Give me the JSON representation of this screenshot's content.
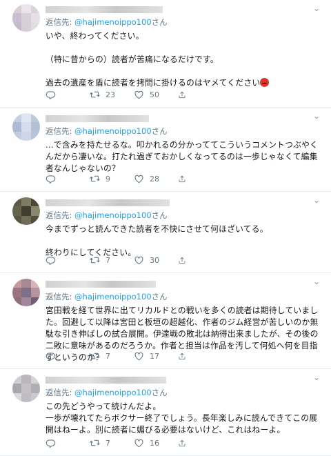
{
  "reply_prefix": "返信先: ",
  "reply_suffix": "さん",
  "tweets": [
    {
      "reply_handle": "@hajimenoippo100",
      "text": "いや、終わってください。\n\n（特に昔からの）読者が苦痛になるだけです。\n\n過去の遺産を盾に読者を拷問に掛けるのはヤメてください",
      "emoji": "angry-face",
      "retweets": "23",
      "likes": "50",
      "avatar_colors": [
        "#d9d0d6",
        "#ebe4ea",
        "#dcd3d9",
        "#c8bfd0",
        "#d8cfd8",
        "#e6e0e6",
        "#c4bccc",
        "#d6cfd6",
        "#e2dce2"
      ]
    },
    {
      "reply_handle": "@hajimenoippo100",
      "text": "...で含みを持たせるな。叩かれるの分かっててこういうコメントつぶやくんだから凄いな。打たれ過ぎておかしくなってるのは一歩じゃなくて編集者なんじゃないの？",
      "retweets": "9",
      "likes": "28",
      "avatar_colors": [
        "#c7cfe3",
        "#dfe5f1",
        "#bcc6dc",
        "#aebad3",
        "#d6dcec",
        "#b3bfd7",
        "#c3cbe0",
        "#cfd6e8",
        "#b8c2da"
      ]
    },
    {
      "reply_handle": "@hajimenoippo100",
      "text": "今までずっと読んできた読者を不快にさせて何ほざいてる。\n\n終わりにしてください。",
      "retweets": "7",
      "likes": "30",
      "avatar_colors": [
        "#5c5a46",
        "#7d7b62",
        "#4a4938",
        "#66644f",
        "#3f3e31",
        "#8a876d",
        "#595743",
        "#706e58",
        "#4f4e3c"
      ]
    },
    {
      "reply_handle": "@hajimenoippo100",
      "text": "宮田戦を経て世界に出てリカルドとの戦いを多くの読者は期待していました。回避して以降は宮田と板垣の超越化、作者のジム経営が苦しいのか無駄な引き伸ばしの試合展開。伊達戦の敗北は納得出来ましたが、その後の二敗に意味があるのだろうか。作者と担当は作品を汚して何処へ何を目指すというのか？",
      "retweets": "7",
      "likes": "17",
      "avatar_colors": [
        "#c89a9e",
        "#a58a94",
        "#d8b2b4",
        "#9c7380",
        "#7d6f86",
        "#b4959d",
        "#8f6f7a",
        "#a2889c",
        "#6e5f73"
      ]
    },
    {
      "reply_handle": "@hajimenoippo100",
      "text": "この先どうやって続けんだよ。\n一歩が壊れてたらボクサー終了でしょう。長年楽しみに読んできてこの展開はねーよ。別に読者に媚びる必要はないけど、これはねーよ。",
      "retweets": "7",
      "likes": "16",
      "avatar_colors": [
        "#cfcfd2",
        "#b9b7bc",
        "#d6d4d8",
        "#a9a6ad",
        "#c3c0c6",
        "#b0aeb4",
        "#d9d7db",
        "#bfbcc2",
        "#cac8cd"
      ]
    }
  ]
}
